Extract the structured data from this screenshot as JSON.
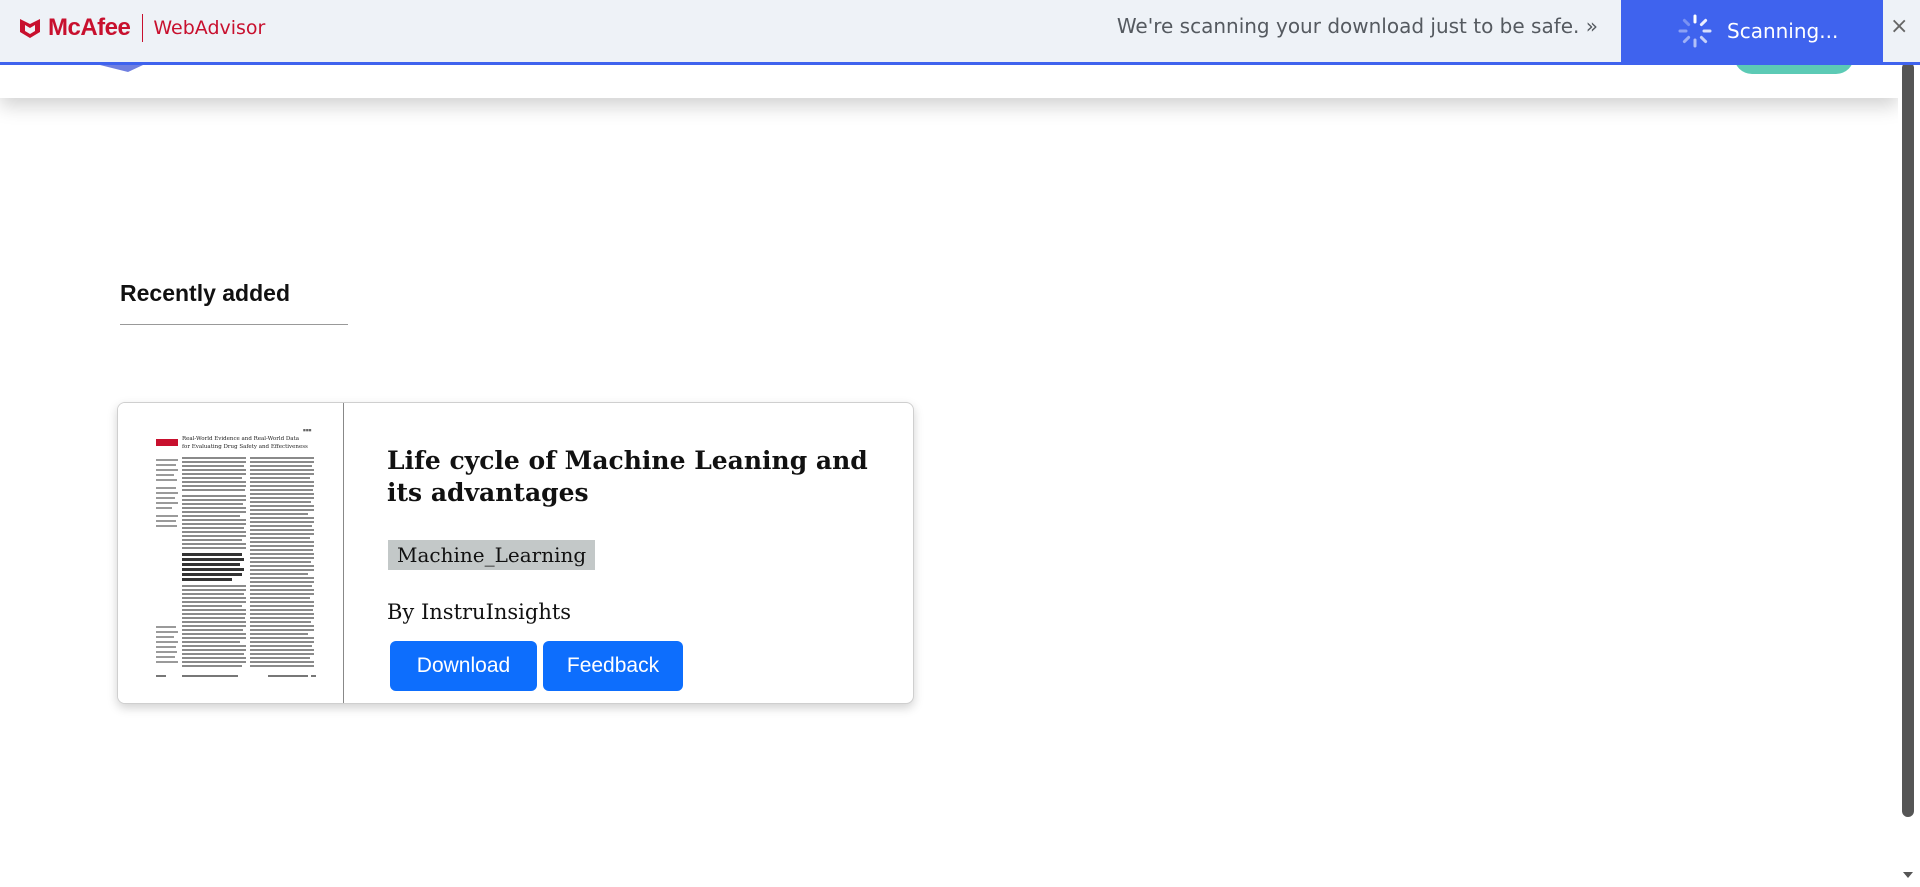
{
  "webadvisor": {
    "brand": "McAfee",
    "product": "WebAdvisor",
    "message": "We're scanning your download just to be safe. »",
    "scanning_label": "Scanning...",
    "close_label": "×",
    "brand_color": "#c8102e",
    "accent_color": "#3f63ee"
  },
  "main": {
    "section_title": "Recently added",
    "cards": [
      {
        "title": "Life cycle of Machine Leaning and its advantages",
        "tag": "Machine_Learning",
        "author": "By InstruInsights",
        "download_label": "Download",
        "feedback_label": "Feedback",
        "thumbnail": {
          "heading_line1": "Real-World Evidence and Real-World Data",
          "heading_line2": "for Evaluating Drug Safety and Effectiveness"
        }
      }
    ]
  },
  "colors": {
    "button_primary": "#0d6efd",
    "tag_background": "#c3c8c8"
  }
}
